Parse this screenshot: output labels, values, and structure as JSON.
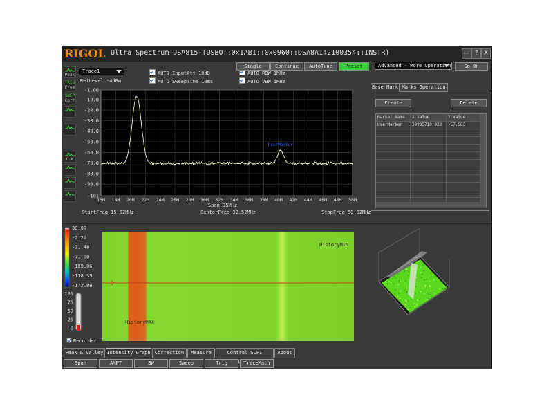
{
  "title": {
    "logo": "RIGOL",
    "text": "Ultra Spectrum-DSA815-(USB0::0x1AB1::0x0960::DSA8A142100354::INSTR)",
    "minimize": "—",
    "help": "?",
    "close": "X"
  },
  "left_tools": [
    {
      "label": "Peak",
      "icon": "peak-icon"
    },
    {
      "label": "Free",
      "top_label": "TRIG",
      "icon": "trig-free-icon"
    },
    {
      "label": "Corr",
      "top_label": "SWEP",
      "icon": "corr-icon"
    },
    {
      "label": "",
      "icon": "wave-icon"
    },
    {
      "label": "",
      "icon": "wave-icon"
    },
    {
      "label": "C.W",
      "icon": "cw-icon"
    },
    {
      "label": "",
      "icon": "wave-icon"
    },
    {
      "label": "",
      "icon": "wave-icon"
    },
    {
      "label": "",
      "icon": "wave-icon"
    }
  ],
  "trace_select": "Trace1",
  "reflevel": "RefLevel  -4dBm",
  "options": {
    "input_att": "AUTO InputAtt  10dB",
    "sweep_time": "AUTO SweepTime  10ms",
    "rbw": "AUTO RBW   1MHz",
    "vbw": "AUTO VBW   1MHz"
  },
  "buttons": {
    "single": "Single",
    "continue": "Continue",
    "autotune": "AutoTune",
    "preset": "Preset",
    "go_on": "Go On"
  },
  "advanced_select": "Advanced - More Operation",
  "right_panel": {
    "tabs": [
      "Base Mark",
      "Marks Operation"
    ],
    "create": "Create",
    "delete": "Delete",
    "columns": [
      "Marker Name",
      "X Value",
      "Y Value"
    ],
    "rows": [
      [
        "UserMarker",
        "39985710.920",
        "-57.563"
      ]
    ]
  },
  "chart_data": {
    "type": "line",
    "y_ticks": [
      "-1.00",
      "-10.0",
      "-20.0",
      "-30.0",
      "-40.0",
      "-50.0",
      "-60.0",
      "-70.0",
      "-80.0",
      "-90.0",
      "-101"
    ],
    "y_values": [
      -1,
      -10,
      -20,
      -30,
      -40,
      -50,
      -60,
      -70,
      -80,
      -90,
      -101
    ],
    "x_ticks": [
      "15M",
      "18M",
      "20M",
      "22M",
      "24M",
      "26M",
      "28M",
      "30M",
      "32M",
      "34M",
      "36M",
      "38M",
      "40M",
      "42M",
      "44M",
      "46M",
      "48M",
      "50M"
    ],
    "x_values": [
      15,
      18,
      20,
      22,
      24,
      26,
      28,
      30,
      32,
      34,
      36,
      38,
      40,
      42,
      44,
      46,
      48,
      50
    ],
    "xlim": [
      15.02,
      50.02
    ],
    "ylim": [
      -101,
      -1
    ],
    "noise_floor": -71,
    "peaks": [
      {
        "x": 20.0,
        "y": -7,
        "width": 0.9
      },
      {
        "x": 40.0,
        "y": -58,
        "width": 0.6
      }
    ],
    "grid": true,
    "span": "Span   35MHz",
    "start_freq": "StartFreq  15.02MHz",
    "center_freq": "CenterFreq   32.52MHz",
    "stop_freq": "StopFreq   50.02MHz",
    "marker_label": "UserMarker"
  },
  "intensity": {
    "scale": [
      "30.00",
      "-2.20",
      "-31.48",
      "-71.00",
      "-109.06",
      "-138.33",
      "-172.00"
    ],
    "level_ticks": [
      "100",
      "75",
      "50",
      "25",
      "0"
    ],
    "level_fraction": 0.15,
    "history_min": "HistoryMIN",
    "history_max": "HistoryMAX",
    "recorder": "Recorder"
  },
  "bottom_tabs": [
    "Peak & Valley",
    "Intensity Graph",
    "Correction",
    "Measure",
    "Control SCPI History",
    "About"
  ],
  "function_buttons": [
    "Span",
    "AMPT",
    "BW",
    "Sweep",
    "Trig",
    "TraceMath"
  ],
  "colors": {
    "trace": "#f2f2c8",
    "plot_bg": "#000000",
    "grid": "#3c3c3c",
    "intensity_bg": "#7fd42e",
    "intensity_band": "#e0601a",
    "logo": "#f08a10"
  }
}
